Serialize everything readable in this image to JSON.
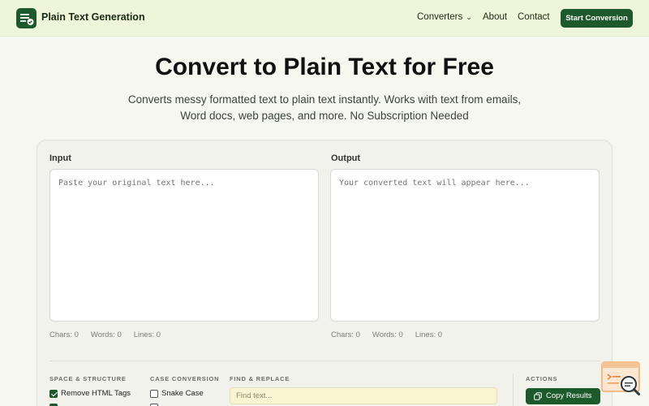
{
  "header": {
    "brand": "Plain Text Generation",
    "nav": {
      "converters": "Converters",
      "about": "About",
      "contact": "Contact"
    },
    "cta": "Start Conversion"
  },
  "hero": {
    "title": "Convert to Plain Text for Free",
    "subtitle_line1": "Converts messy formatted text to plain text instantly. Works with text from emails,",
    "subtitle_line2": "Word docs, web pages, and more. No Subscription Needed"
  },
  "input_panel": {
    "label": "Input",
    "placeholder": "Paste your original text here...",
    "stats": {
      "chars": "Chars: 0",
      "words": "Words: 0",
      "lines": "Lines: 0"
    }
  },
  "output_panel": {
    "label": "Output",
    "placeholder": "Your converted text will appear here...",
    "stats": {
      "chars": "Chars: 0",
      "words": "Words: 0",
      "lines": "Lines: 0"
    }
  },
  "options": {
    "space_structure": {
      "heading": "SPACE & STRUCTURE",
      "items": [
        {
          "label": "Remove HTML Tags",
          "checked": true
        }
      ]
    },
    "case_conversion": {
      "heading": "CASE CONVERSION",
      "items": [
        {
          "label": "Snake Case",
          "checked": false
        }
      ]
    },
    "find_replace": {
      "heading": "FIND & REPLACE",
      "find_placeholder": "Find text..."
    },
    "actions": {
      "heading": "ACTIONS",
      "copy_label": "Copy Results"
    }
  },
  "colors": {
    "brand_green": "#1d5a2b",
    "header_bg": "#eef5d9",
    "page_bg": "#f6f8ef",
    "find_input_bg": "#fbf5d2",
    "widget_accent": "#f0a05a"
  },
  "icons": {
    "logo": "document-check-icon",
    "converters_chevron": "chevron-down-icon",
    "copy": "copy-icon",
    "chat_widget": "search-chat-icon"
  }
}
